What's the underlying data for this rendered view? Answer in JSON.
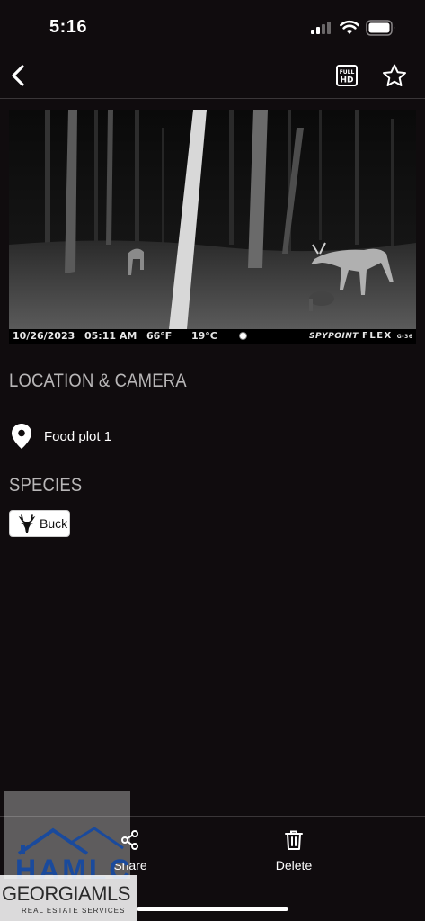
{
  "status_bar": {
    "time": "5:16",
    "icons": [
      "signal-icon",
      "wifi-icon",
      "battery-icon"
    ]
  },
  "nav": {
    "icons": [
      "back-chevron-icon",
      "full-hd-icon",
      "star-icon"
    ],
    "hd_badge_line1": "FULL",
    "hd_badge_line2": "HD"
  },
  "photo": {
    "date": "10/26/2023",
    "time": "05:11 AM",
    "temp_f": "66°F",
    "temp_c": "19°C",
    "brand": "SPYPOINT",
    "model": "FLEX",
    "model_suffix": "G-36"
  },
  "location_section": {
    "title": "LOCATION & CAMERA",
    "camera_name": "Food plot 1",
    "icon": "map-pin-icon"
  },
  "species_section": {
    "title": "SPECIES",
    "tags": [
      {
        "label": "Buck",
        "icon": "buck-icon"
      }
    ]
  },
  "toolbar": {
    "share_label": "Share",
    "delete_label": "Delete",
    "icons": [
      "share-icon",
      "trash-icon"
    ]
  },
  "watermark": {
    "company": "HAMLC",
    "mls": "GEORGIAMLS",
    "sub": "REAL ESTATE SERVICES"
  },
  "colors": {
    "background": "#100c0e",
    "section_title": "#b8b6b7",
    "chip_background": "#ffffff",
    "divider": "#3a3638"
  }
}
